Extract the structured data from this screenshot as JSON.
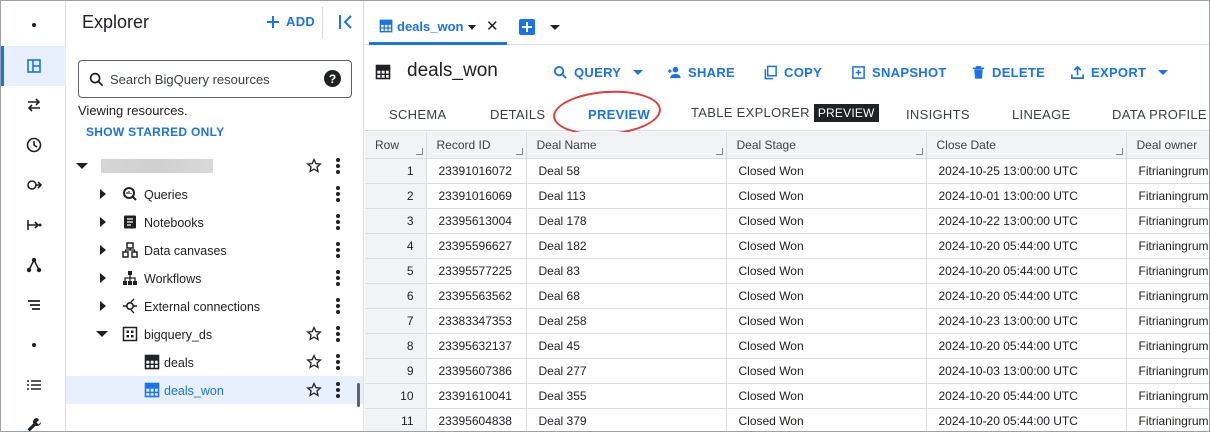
{
  "explorer": {
    "title": "Explorer",
    "add_label": "ADD",
    "search_placeholder": "Search BigQuery resources",
    "help_glyph": "?",
    "viewing_text": "Viewing resources.",
    "show_starred": "SHOW STARRED ONLY",
    "tree": {
      "project_name": "",
      "items": [
        {
          "label": "Queries",
          "icon": "queries-icon"
        },
        {
          "label": "Notebooks",
          "icon": "notebook-icon"
        },
        {
          "label": "Data canvases",
          "icon": "data-canvas-icon"
        },
        {
          "label": "Workflows",
          "icon": "workflow-icon"
        },
        {
          "label": "External connections",
          "icon": "external-connection-icon"
        }
      ],
      "dataset": {
        "label": "bigquery_ds",
        "icon": "dataset-icon"
      },
      "tables": [
        {
          "label": "deals",
          "icon": "table-icon",
          "selected": false
        },
        {
          "label": "deals_won",
          "icon": "table-icon",
          "selected": true
        }
      ]
    }
  },
  "tabs": {
    "active_tab": "deals_won",
    "close_glyph": "✕"
  },
  "toolbar": {
    "table_name": "deals_won",
    "query": "QUERY",
    "share": "SHARE",
    "copy": "COPY",
    "snapshot": "SNAPSHOT",
    "delete": "DELETE",
    "export": "EXPORT"
  },
  "subtabs": {
    "schema": "SCHEMA",
    "details": "DETAILS",
    "preview": "PREVIEW",
    "table_explorer": "TABLE EXPLORER",
    "table_explorer_badge": "PREVIEW",
    "insights": "INSIGHTS",
    "lineage": "LINEAGE",
    "data_profile": "DATA PROFILE"
  },
  "accent_color": "#1a73e8",
  "highlight_color": "#e03b3b",
  "grid": {
    "columns": [
      "Row",
      "Record ID",
      "Deal Name",
      "Deal Stage",
      "Close Date",
      "Deal owner"
    ],
    "rows": [
      [
        "1",
        "23391016072",
        "Deal 58",
        "Closed Won",
        "2024-10-25 13:00:00 UTC",
        "Fitrianingrum"
      ],
      [
        "2",
        "23391016069",
        "Deal 113",
        "Closed Won",
        "2024-10-01 13:00:00 UTC",
        "Fitrianingrum"
      ],
      [
        "3",
        "23395613004",
        "Deal 178",
        "Closed Won",
        "2024-10-22 13:00:00 UTC",
        "Fitrianingrum"
      ],
      [
        "4",
        "23395596627",
        "Deal 182",
        "Closed Won",
        "2024-10-20 05:44:00 UTC",
        "Fitrianingrum"
      ],
      [
        "5",
        "23395577225",
        "Deal 83",
        "Closed Won",
        "2024-10-20 05:44:00 UTC",
        "Fitrianingrum"
      ],
      [
        "6",
        "23395563562",
        "Deal 68",
        "Closed Won",
        "2024-10-20 05:44:00 UTC",
        "Fitrianingrum"
      ],
      [
        "7",
        "23383347353",
        "Deal 258",
        "Closed Won",
        "2024-10-23 13:00:00 UTC",
        "Fitrianingrum"
      ],
      [
        "8",
        "23395632137",
        "Deal 45",
        "Closed Won",
        "2024-10-20 05:44:00 UTC",
        "Fitrianingrum"
      ],
      [
        "9",
        "23395607386",
        "Deal 277",
        "Closed Won",
        "2024-10-03 13:00:00 UTC",
        "Fitrianingrum"
      ],
      [
        "10",
        "23391610041",
        "Deal 355",
        "Closed Won",
        "2024-10-20 05:44:00 UTC",
        "Fitrianingrum"
      ],
      [
        "11",
        "23395604838",
        "Deal 379",
        "Closed Won",
        "2024-10-20 05:44:00 UTC",
        "Fitrianingrum"
      ]
    ]
  }
}
